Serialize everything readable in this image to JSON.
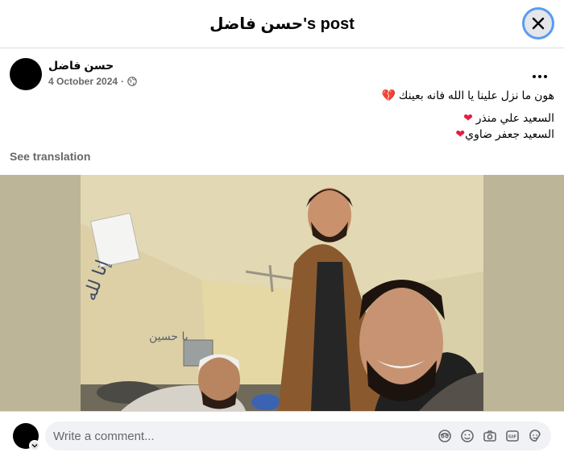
{
  "modal": {
    "title": "حسن فاضل's post"
  },
  "post": {
    "author": "حسن فاضل",
    "date": "4 October 2024",
    "separator": "·",
    "lines": [
      "هون ما نزل علينا يا الله فانه بعينك",
      "السعيد علي منذر",
      "السعيد جعفر ضاوي"
    ],
    "see_translation": "See translation"
  },
  "photo": {
    "wall_calligraphy_1": "إنا لله",
    "wall_calligraphy_2": "يا حسين"
  },
  "comment": {
    "placeholder": "Write a comment..."
  },
  "icons": {
    "close": "close-icon",
    "globe": "globe-icon",
    "more": "more-options-icon",
    "avatar_sticker": "avatar-sticker-icon",
    "emoji": "emoji-icon",
    "camera": "camera-icon",
    "gif": "gif-icon",
    "sticker": "sticker-icon"
  },
  "colors": {
    "heart": "#e41e3f",
    "broken_heart": "#c62d56",
    "focus_ring": "#5b9bf0"
  }
}
